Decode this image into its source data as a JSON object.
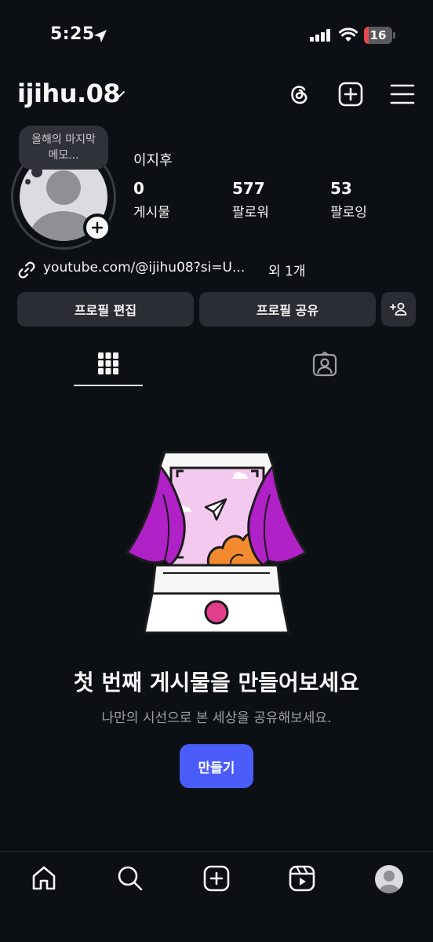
{
  "status_bar": {
    "time": "5:25",
    "battery": "16",
    "battery_level": 0.16,
    "battery_color": "#e5484d"
  },
  "header": {
    "username": "ijihu.08",
    "icons": [
      "chevron-down-icon",
      "threads-icon",
      "plus-square-icon",
      "hamburger-menu-icon"
    ]
  },
  "profile": {
    "note_line1": "올해의 마지막",
    "note_line2": "메모...",
    "display_name": "이지후",
    "stats": [
      {
        "count": "0",
        "label": "게시물"
      },
      {
        "count": "577",
        "label": "팔로워"
      },
      {
        "count": "53",
        "label": "팔로잉"
      }
    ],
    "link_text": "youtube.com/@ijihu08?si=U...",
    "link_more": "외 1개"
  },
  "buttons": {
    "edit_profile": "프로필 편집",
    "share_profile": "프로필 공유",
    "add_person_icon": "add-person-icon"
  },
  "tabs": [
    {
      "icon": "grid-icon",
      "active": true
    },
    {
      "icon": "tagged-person-icon",
      "active": false
    }
  ],
  "empty_state": {
    "title": "첫 번째 게시물을 만들어보세요",
    "subtitle": "나만의 시선으로 본 세상을 공유해보세요.",
    "create_label": "만들기",
    "accent_color": "#4a5df9"
  },
  "bottom_nav": [
    "home-icon",
    "search-icon",
    "create-icon",
    "reels-icon",
    "profile-avatar"
  ]
}
